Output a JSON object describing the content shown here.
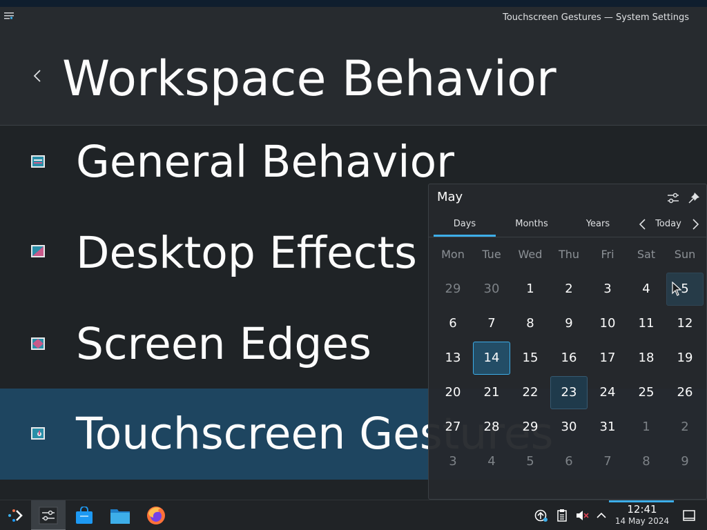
{
  "window": {
    "title": "Touchscreen Gestures — System Settings"
  },
  "header": {
    "page_title": "Workspace Behavior",
    "back_icon": "chevron-left-icon"
  },
  "list": {
    "items": [
      {
        "label": "General Behavior",
        "icon": "general-behavior-icon",
        "selected": false
      },
      {
        "label": "Desktop Effects",
        "icon": "desktop-effects-icon",
        "selected": false
      },
      {
        "label": "Screen Edges",
        "icon": "screen-edges-icon",
        "selected": false
      },
      {
        "label": "Touchscreen Gestures",
        "icon": "touchscreen-icon",
        "selected": true
      }
    ]
  },
  "calendar": {
    "month": "May",
    "tabs": [
      "Days",
      "Months",
      "Years"
    ],
    "active_tab": "Days",
    "today_label": "Today",
    "weekdays": [
      "Mon",
      "Tue",
      "Wed",
      "Thu",
      "Fri",
      "Sat",
      "Sun"
    ],
    "weeks": [
      [
        "29",
        "30",
        "1",
        "2",
        "3",
        "4",
        "5"
      ],
      [
        "6",
        "7",
        "8",
        "9",
        "10",
        "11",
        "12"
      ],
      [
        "13",
        "14",
        "15",
        "16",
        "17",
        "18",
        "19"
      ],
      [
        "20",
        "21",
        "22",
        "23",
        "24",
        "25",
        "26"
      ],
      [
        "27",
        "28",
        "29",
        "30",
        "31",
        "1",
        "2"
      ],
      [
        "3",
        "4",
        "5",
        "6",
        "7",
        "8",
        "9"
      ]
    ],
    "today": "14",
    "selected": "23",
    "hovered": "5",
    "accent_color": "#3daee9"
  },
  "taskbar": {
    "apps": [
      "application-launcher-icon",
      "system-settings-icon",
      "discover-store-icon",
      "dolphin-files-icon",
      "firefox-icon"
    ],
    "tray": [
      "updates-icon",
      "clipboard-icon",
      "volume-muted-icon",
      "tray-expand-icon"
    ],
    "clock_time": "12:41",
    "clock_date": "14 May 2024",
    "show_desktop_icon": "show-desktop-icon"
  }
}
